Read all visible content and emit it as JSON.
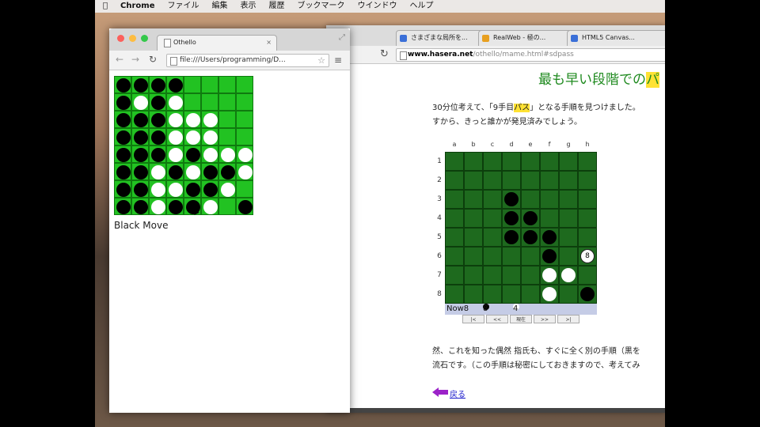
{
  "menubar": {
    "apple": "",
    "app": "Chrome",
    "items": [
      "ファイル",
      "編集",
      "表示",
      "履歴",
      "ブックマーク",
      "ウインドウ",
      "ヘルプ"
    ]
  },
  "front_window": {
    "tab_title": "Othello",
    "tab_close": "×",
    "url": "file:///Users/programming/D...",
    "status": "Black Move",
    "board": [
      "BBBB....",
      "BWBW....",
      "BBBWWW..",
      "BBBWWW..",
      "BBBWBWWW",
      "BBWBWBBW",
      "BBWWBBW.",
      "BBWBBW.B"
    ]
  },
  "back_window": {
    "tabs": [
      {
        "title": "さまざまな局所を...",
        "color": "#3a6fd8"
      },
      {
        "title": "RealWeb - 極の...",
        "color": "#e8a020"
      },
      {
        "title": "HTML5 Canvas...",
        "color": "#3a6fd8"
      }
    ],
    "tab_close": "×",
    "url_host": "www.hasera.net",
    "url_path": "/othello/mame.html#sdpass",
    "heading": "最も早い段階での",
    "heading_highlight": "パ",
    "para1_line1_a": "30分位考えて、「9手目",
    "para1_line1_hl": "パス",
    "para1_line1_b": "」となる手順を見つけました。",
    "para1_line2": "すから、きっと誰かが発見済みでしょう。",
    "para2_line1": "然、これを知った偶然 指氏も、すぐに全く別の手順（黒を",
    "para2_line2": "流石です。（この手順は秘密にしておきますので、考えてみ",
    "link": "戻る",
    "board_cols": [
      "a",
      "b",
      "c",
      "d",
      "e",
      "f",
      "g",
      "h"
    ],
    "board_rows": [
      "1",
      "2",
      "3",
      "4",
      "5",
      "6",
      "7",
      "8"
    ],
    "board": [
      "........",
      "........",
      "...B....",
      "...BB...",
      "...BBB..",
      ".....B.M",
      ".....WW.",
      ".....W.B"
    ],
    "last_move_label": "8",
    "status_now": "Now8",
    "status_black": "8",
    "status_white": "4",
    "nav_buttons": [
      "|<",
      "<<",
      "現在",
      ">>",
      ">|"
    ]
  }
}
